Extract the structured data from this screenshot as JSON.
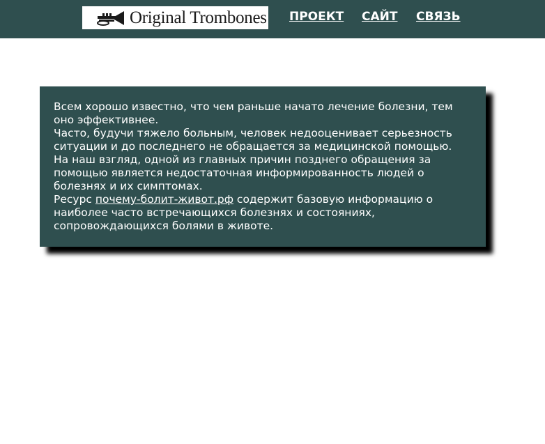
{
  "header": {
    "logo_text": "Original Trombones",
    "logo_icon": "trumpet-icon",
    "nav": [
      {
        "label": "ПРОЕКТ"
      },
      {
        "label": "САЙТ"
      },
      {
        "label": "СВЯЗЬ"
      }
    ],
    "background_color": "#2f4f4f"
  },
  "card": {
    "background_color": "#2f4f4f",
    "paragraphs": [
      "Всем хорошо известно, что чем раньше начато лечение болезни, тем оно эффективнее.",
      "Часто, будучи тяжело больным, человек недооценивает серьезность ситуации и до последнего не обращается за медицинской помощью.",
      "На наш взгляд, одной из главных причин позднего обращения за помощью является недостаточная информированность людей о болезнях и их симптомах."
    ],
    "last_paragraph": {
      "prefix": "Ресурс ",
      "link_text": "почему-болит-живот.рф",
      "suffix": " содержит базовую информацию о наиболее часто встречающихся болезнях и состояниях, сопровождающихся болями в животе."
    }
  }
}
